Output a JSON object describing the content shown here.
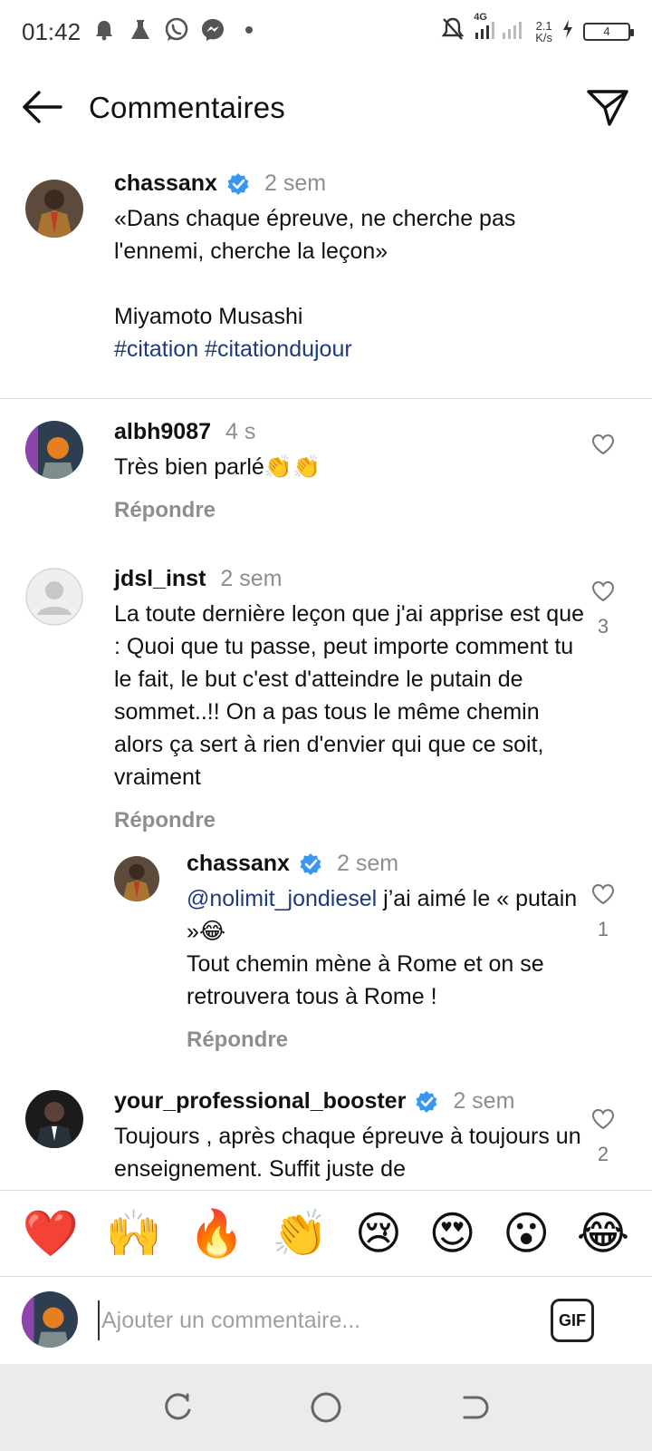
{
  "status_bar": {
    "time": "01:42",
    "network": "4G",
    "speed_value": "2.1",
    "speed_unit": "K/s",
    "battery": "4",
    "left_icons": [
      "alarm-icon",
      "lab-flask-icon",
      "whatsapp-icon",
      "messenger-icon",
      "dot-icon"
    ],
    "right_icons": [
      "mute-icon",
      "signal-icon",
      "charging-icon"
    ]
  },
  "header": {
    "title": "Commentaires",
    "back_icon": "arrow-left-icon",
    "share_icon": "paper-plane-icon"
  },
  "post": {
    "username": "chassanx",
    "time": "2 sem",
    "verified": true,
    "text_line1": "«Dans chaque épreuve, ne cherche pas",
    "text_line2": "l'ennemi, cherche la leçon»",
    "author": "Miyamoto Musashi",
    "hashtag1": "#citation",
    "hashtag2": "#citationdujour"
  },
  "comments": [
    {
      "username": "albh9087",
      "time": "4 s",
      "text": "Très bien parlé👏👏",
      "reply": "Répondre",
      "likes": ""
    },
    {
      "username": "jdsl_inst",
      "time": "2 sem",
      "text": "La toute dernière leçon que j'ai apprise est que : Quoi que tu passe, peut importe comment tu le fait, le but c'est d'atteindre le putain de sommet..!! On a pas tous le même chemin alors ça sert à rien d'envier qui que ce soit, vraiment",
      "reply": "Répondre",
      "likes": "3"
    },
    {
      "username": "chassanx",
      "time": "2 sem",
      "mention": "@nolimit_jondiesel",
      "text_after_mention": " j’ai aimé le « putain »😂",
      "text_line2": "Tout chemin mène à Rome et on se retrouvera tous à Rome !",
      "reply": "Répondre",
      "likes": "1"
    },
    {
      "username": "your_professional_booster",
      "time": "2 sem",
      "text": "Toujours , après chaque épreuve à toujours un enseignement. Suffit juste de",
      "likes": "2"
    }
  ],
  "emoji_bar": [
    "❤️",
    "🙌",
    "🔥",
    "👏",
    "😢",
    "😍",
    "😮",
    "😂"
  ],
  "input": {
    "placeholder": "Ajouter un commentaire...",
    "gif_label": "GIF"
  },
  "colors": {
    "link": "#1e3a7b",
    "muted": "#8e8e8e",
    "verified": "#3897f0",
    "divider": "#dbdbdb",
    "navbar_bg": "#ebebeb"
  }
}
